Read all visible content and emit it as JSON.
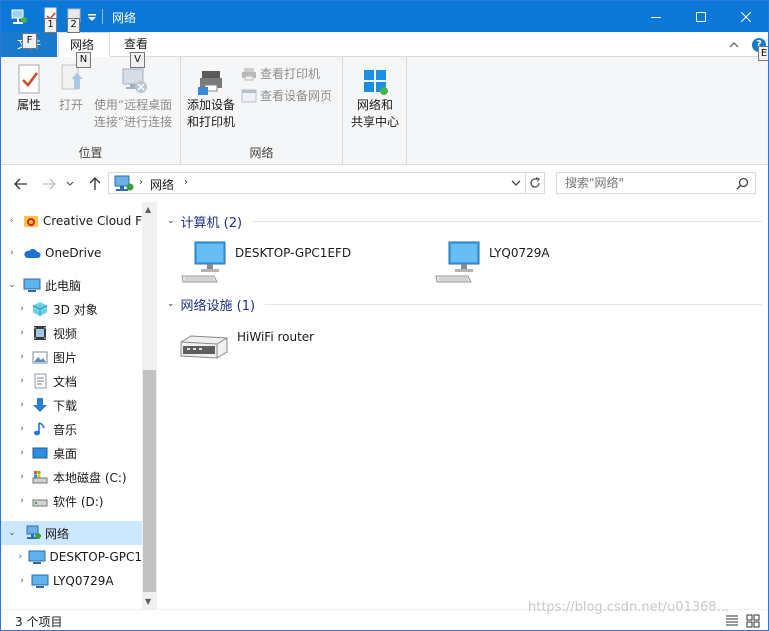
{
  "window": {
    "title": "网络",
    "keytips": [
      "1",
      "2",
      "F",
      "N",
      "V",
      "E"
    ]
  },
  "ribbon": {
    "tabs": {
      "file": "文件",
      "network": "网络",
      "view": "查看"
    },
    "help": "?",
    "location_group": {
      "label": "位置",
      "properties": "属性",
      "open": "打开",
      "remote_line1": "使用“远程桌面",
      "remote_line2": "连接”进行连接"
    },
    "network_group": {
      "label": "网络",
      "add_line1": "添加设备",
      "add_line2": "和打印机",
      "view_printers": "查看打印机",
      "view_webpages": "查看设备网页"
    },
    "center_group": {
      "line1": "网络和",
      "line2": "共享中心"
    }
  },
  "address": {
    "crumb": "网络",
    "search_placeholder": "搜索\"网络\""
  },
  "nav_pane": {
    "items": [
      {
        "label": "Creative Cloud F",
        "icon": "creative-cloud-icon"
      },
      {
        "label": "OneDrive",
        "icon": "onedrive-cloud-icon"
      },
      {
        "label": "此电脑",
        "icon": "this-pc-icon"
      },
      {
        "label": "3D 对象",
        "icon": "3d-objects-icon"
      },
      {
        "label": "视频",
        "icon": "videos-icon"
      },
      {
        "label": "图片",
        "icon": "pictures-icon"
      },
      {
        "label": "文档",
        "icon": "documents-icon"
      },
      {
        "label": "下载",
        "icon": "downloads-icon"
      },
      {
        "label": "音乐",
        "icon": "music-icon"
      },
      {
        "label": "桌面",
        "icon": "desktop-icon"
      },
      {
        "label": "本地磁盘 (C:)",
        "icon": "local-disk-icon"
      },
      {
        "label": "软件 (D:)",
        "icon": "drive-icon"
      },
      {
        "label": "网络",
        "icon": "network-icon"
      },
      {
        "label": "DESKTOP-GPC1",
        "icon": "computer-icon"
      },
      {
        "label": "LYQ0729A",
        "icon": "computer-icon"
      }
    ]
  },
  "content": {
    "computers_header": "计算机 (2)",
    "computers": [
      "DESKTOP-GPC1EFD",
      "LYQ0729A"
    ],
    "infra_header": "网络设施 (1)",
    "infra": [
      "HiWiFi router"
    ]
  },
  "status": {
    "item_count": "3 个项目",
    "watermark": "https://blog.csdn.net/u01368..."
  },
  "colors": {
    "accent": "#0b78d7",
    "selected": "#cce8ff",
    "group_header": "#1e3287"
  }
}
